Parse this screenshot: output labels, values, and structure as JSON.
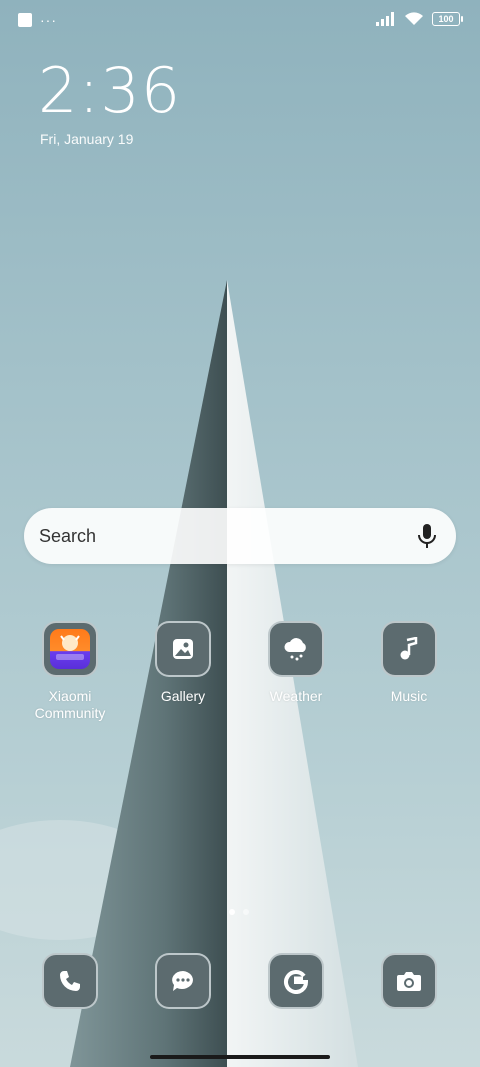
{
  "status_bar": {
    "notification_dots": "···",
    "battery_level": "100"
  },
  "lockscreen": {
    "time": "2:36",
    "date": "Fri, January 19"
  },
  "search": {
    "label": "Search"
  },
  "apps": [
    {
      "label": "Xiaomi Community",
      "icon": "xiaomi-community-icon"
    },
    {
      "label": "Gallery",
      "icon": "gallery-icon"
    },
    {
      "label": "Weather",
      "icon": "weather-icon"
    },
    {
      "label": "Music",
      "icon": "music-icon"
    }
  ],
  "dock": [
    {
      "icon": "phone-icon"
    },
    {
      "icon": "messages-icon"
    },
    {
      "icon": "google-icon"
    },
    {
      "icon": "camera-icon"
    }
  ],
  "pages": {
    "count": 2,
    "active": 1
  },
  "colors": {
    "icon_bg": "#5c6b6f",
    "icon_border": "#c8d2d4",
    "sky": "#9fbcc4"
  }
}
